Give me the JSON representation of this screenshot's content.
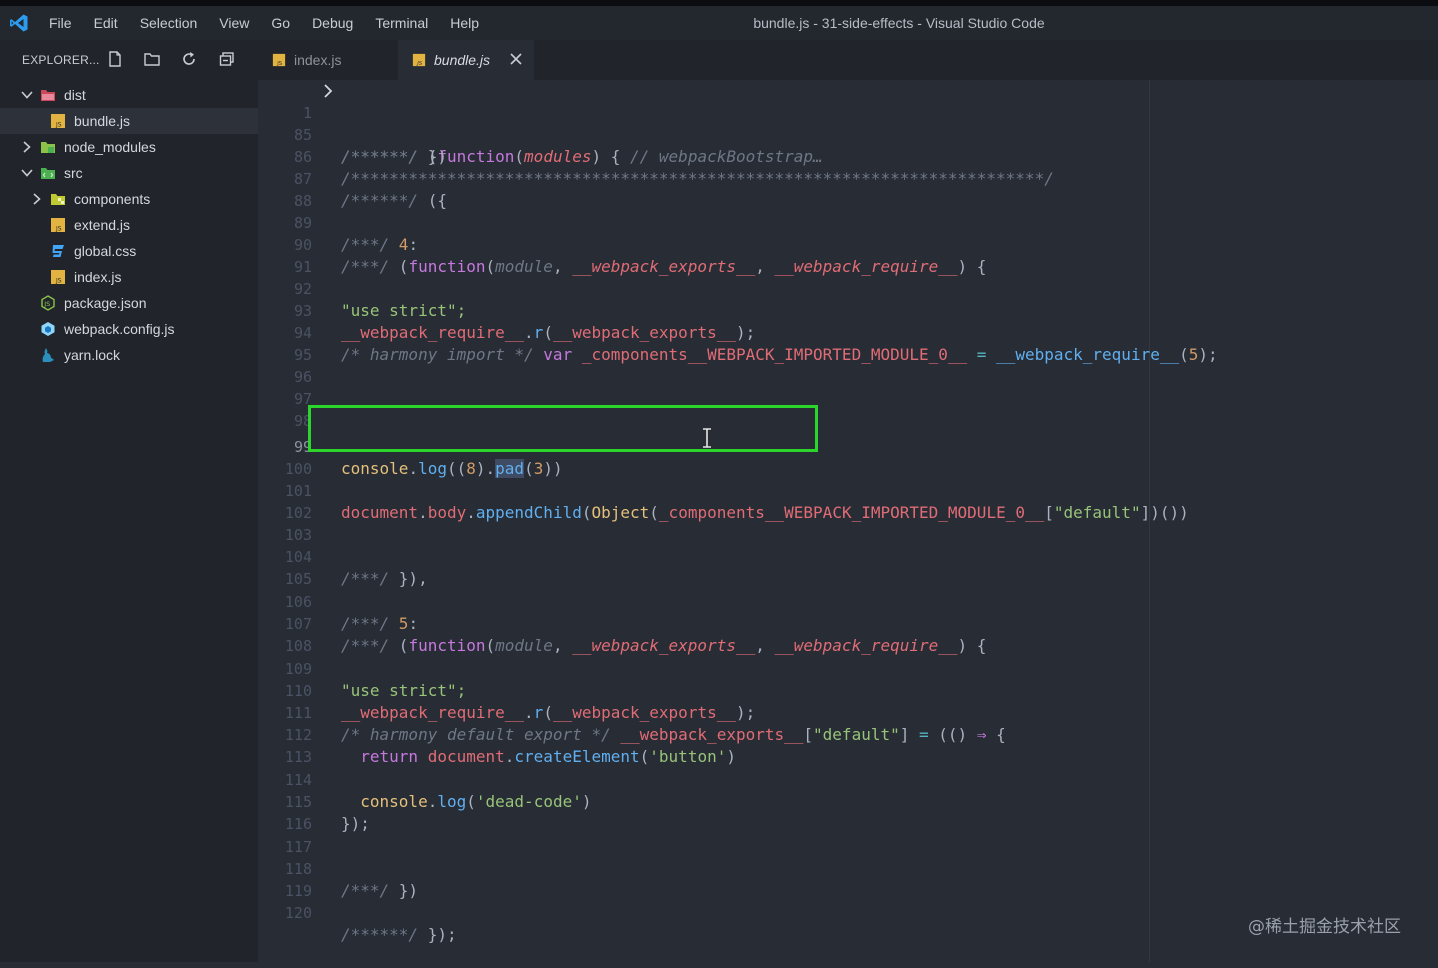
{
  "window": {
    "title": "bundle.js - 31-side-effects - Visual Studio Code",
    "menu": [
      "File",
      "Edit",
      "Selection",
      "View",
      "Go",
      "Debug",
      "Terminal",
      "Help"
    ]
  },
  "explorer": {
    "title": "EXPLORER...",
    "tree": [
      {
        "label": "dist",
        "type": "folder",
        "expanded": true
      },
      {
        "label": "bundle.js",
        "type": "js",
        "selected": true
      },
      {
        "label": "node_modules",
        "type": "folder",
        "expanded": false
      },
      {
        "label": "src",
        "type": "folder",
        "expanded": true
      },
      {
        "label": "components",
        "type": "folder",
        "expanded": false
      },
      {
        "label": "extend.js",
        "type": "js"
      },
      {
        "label": "global.css",
        "type": "css"
      },
      {
        "label": "index.js",
        "type": "js"
      },
      {
        "label": "package.json",
        "type": "json"
      },
      {
        "label": "webpack.config.js",
        "type": "webpack"
      },
      {
        "label": "yarn.lock",
        "type": "yarn"
      }
    ]
  },
  "tabs": [
    {
      "label": "index.js",
      "active": false
    },
    {
      "label": "bundle.js",
      "active": true
    }
  ],
  "editor": {
    "lines": [
      {
        "n": "1",
        "code": "/******/ (function(modules) { // webpackBootstrap…"
      },
      {
        "n": "85",
        "code": "/******/ })"
      },
      {
        "n": "86",
        "code": "/************************************************************************/"
      },
      {
        "n": "87",
        "code": "/******/ ({"
      },
      {
        "n": "88",
        "code": ""
      },
      {
        "n": "89",
        "code": "/***/ 4:"
      },
      {
        "n": "90",
        "code": "/***/ (function(module, __webpack_exports__, __webpack_require__) {"
      },
      {
        "n": "91",
        "code": ""
      },
      {
        "n": "92",
        "code": "\"use strict\";"
      },
      {
        "n": "93",
        "code": "__webpack_require__.r(__webpack_exports__);"
      },
      {
        "n": "94",
        "code": "/* harmony import */ var _components__WEBPACK_IMPORTED_MODULE_0__ = __webpack_require__(5);"
      },
      {
        "n": "95",
        "code": ""
      },
      {
        "n": "96",
        "code": ""
      },
      {
        "n": "97",
        "code": ""
      },
      {
        "n": "98",
        "code": ""
      },
      {
        "n": "99",
        "code": "console.log((8).pad(3))"
      },
      {
        "n": "100",
        "code": ""
      },
      {
        "n": "101",
        "code": "document.body.appendChild(Object(_components__WEBPACK_IMPORTED_MODULE_0__[\"default\"])())"
      },
      {
        "n": "102",
        "code": ""
      },
      {
        "n": "103",
        "code": ""
      },
      {
        "n": "104",
        "code": "/***/ }),"
      },
      {
        "n": "105",
        "code": ""
      },
      {
        "n": "106",
        "code": "/***/ 5:"
      },
      {
        "n": "107",
        "code": "/***/ (function(module, __webpack_exports__, __webpack_require__) {"
      },
      {
        "n": "108",
        "code": ""
      },
      {
        "n": "109",
        "code": "\"use strict\";"
      },
      {
        "n": "110",
        "code": "__webpack_require__.r(__webpack_exports__);"
      },
      {
        "n": "111",
        "code": "/* harmony default export */ __webpack_exports__[\"default\"] = (() ⇒ {"
      },
      {
        "n": "112",
        "code": "  return document.createElement('button')"
      },
      {
        "n": "113",
        "code": ""
      },
      {
        "n": "114",
        "code": "  console.log('dead-code')"
      },
      {
        "n": "115",
        "code": "});"
      },
      {
        "n": "116",
        "code": ""
      },
      {
        "n": "117",
        "code": ""
      },
      {
        "n": "118",
        "code": "/***/ })"
      },
      {
        "n": "119",
        "code": ""
      },
      {
        "n": "120",
        "code": "/******/ });"
      }
    ]
  },
  "watermark": "@稀土掘金技术社区",
  "colors": {
    "accent_highlight": "#2bd52b",
    "editor_bg": "#272c35",
    "sidebar_bg": "#21252b"
  }
}
